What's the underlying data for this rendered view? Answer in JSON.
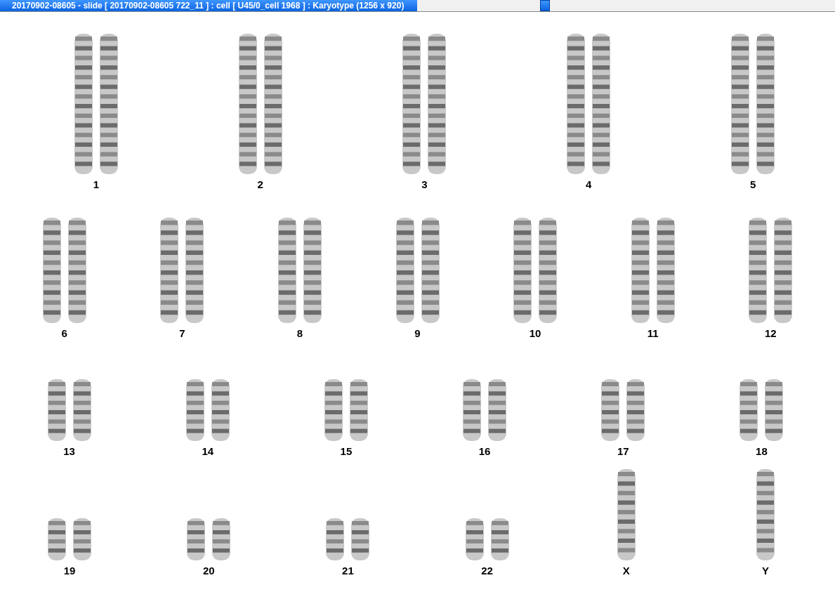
{
  "window": {
    "title": "20170902-08605 - slide [ 20170902-08605 722_11 ] : cell [ U45/0_cell 1968 ] : Karyotype  (1256 x 920)"
  },
  "karyotype": {
    "rows": [
      [
        {
          "label": "1",
          "kind": "pair"
        },
        {
          "label": "2",
          "kind": "pair"
        },
        {
          "label": "3",
          "kind": "pair"
        },
        {
          "label": "4",
          "kind": "pair"
        },
        {
          "label": "5",
          "kind": "pair"
        }
      ],
      [
        {
          "label": "6",
          "kind": "pair"
        },
        {
          "label": "7",
          "kind": "pair"
        },
        {
          "label": "8",
          "kind": "pair"
        },
        {
          "label": "9",
          "kind": "pair"
        },
        {
          "label": "10",
          "kind": "pair"
        },
        {
          "label": "11",
          "kind": "pair"
        },
        {
          "label": "12",
          "kind": "pair"
        }
      ],
      [
        {
          "label": "13",
          "kind": "pair"
        },
        {
          "label": "14",
          "kind": "pair"
        },
        {
          "label": "15",
          "kind": "pair"
        },
        {
          "label": "16",
          "kind": "pair"
        },
        {
          "label": "17",
          "kind": "pair"
        },
        {
          "label": "18",
          "kind": "pair"
        }
      ],
      [
        {
          "label": "19",
          "kind": "pair"
        },
        {
          "label": "20",
          "kind": "pair"
        },
        {
          "label": "21",
          "kind": "pair"
        },
        {
          "label": "22",
          "kind": "pair"
        },
        {
          "label": "X",
          "kind": "single"
        },
        {
          "label": "Y",
          "kind": "single"
        }
      ]
    ]
  }
}
